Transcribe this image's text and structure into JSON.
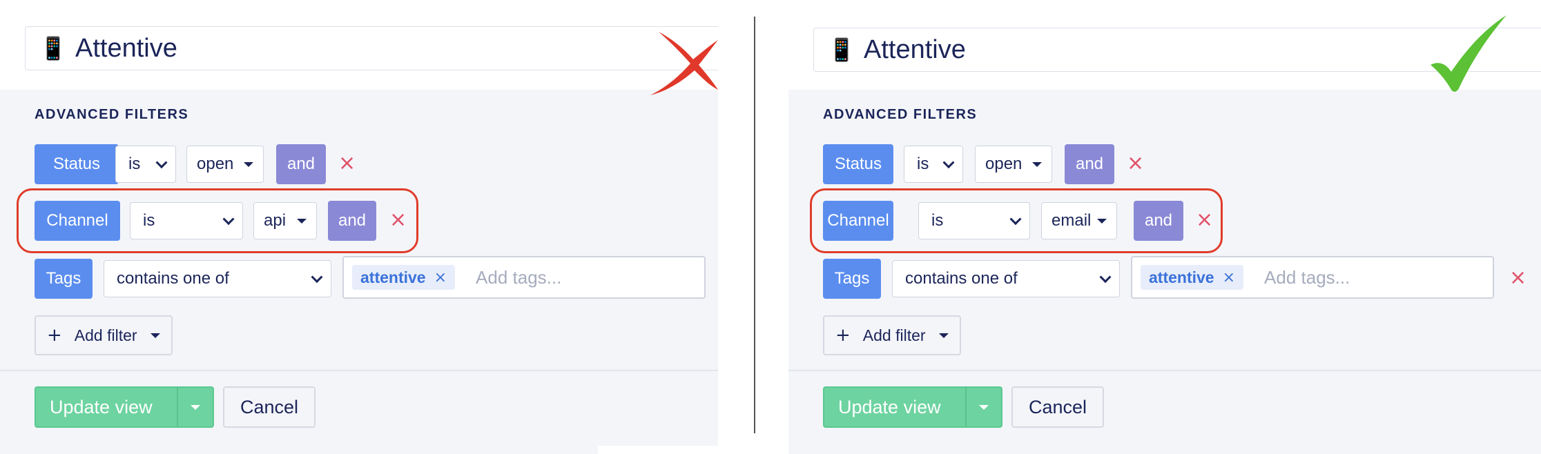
{
  "header": {
    "icon": "mobile-phone-icon",
    "title": "Attentive"
  },
  "section_label": "ADVANCED FILTERS",
  "panels": {
    "left": {
      "verdict_icon": "cross-mark-icon",
      "status_row": {
        "field": "Status",
        "operator": "is",
        "value": "open",
        "conjunction": "and",
        "remove": "×"
      },
      "channel_row": {
        "field": "Channel",
        "operator": "is",
        "value": "api",
        "conjunction": "and",
        "remove": "×"
      },
      "tags_row": {
        "field": "Tags",
        "operator": "contains one of",
        "tag": "attentive",
        "tag_remove": "×",
        "placeholder": "Add tags..."
      }
    },
    "right": {
      "verdict_icon": "check-mark-icon",
      "status_row": {
        "field": "Status",
        "operator": "is",
        "value": "open",
        "conjunction": "and",
        "remove": "×"
      },
      "channel_row": {
        "field": "Channel",
        "operator": "is",
        "value": "email",
        "conjunction": "and",
        "remove": "×"
      },
      "tags_row": {
        "field": "Tags",
        "operator": "contains one of",
        "tag": "attentive",
        "tag_remove": "×",
        "placeholder": "Add tags...",
        "remove": "×"
      }
    }
  },
  "actions": {
    "add_filter": "Add filter",
    "add_icon": "+",
    "update_view": "Update view",
    "cancel": "Cancel"
  },
  "colors": {
    "field_chip": "#5b8def",
    "conjunction_chip": "#8a89d6",
    "remove": "#e05068",
    "primary_button": "#6dd3a0",
    "highlight": "#e03c2a",
    "cross_mark": "#e0382a",
    "check_mark": "#5cc135"
  }
}
